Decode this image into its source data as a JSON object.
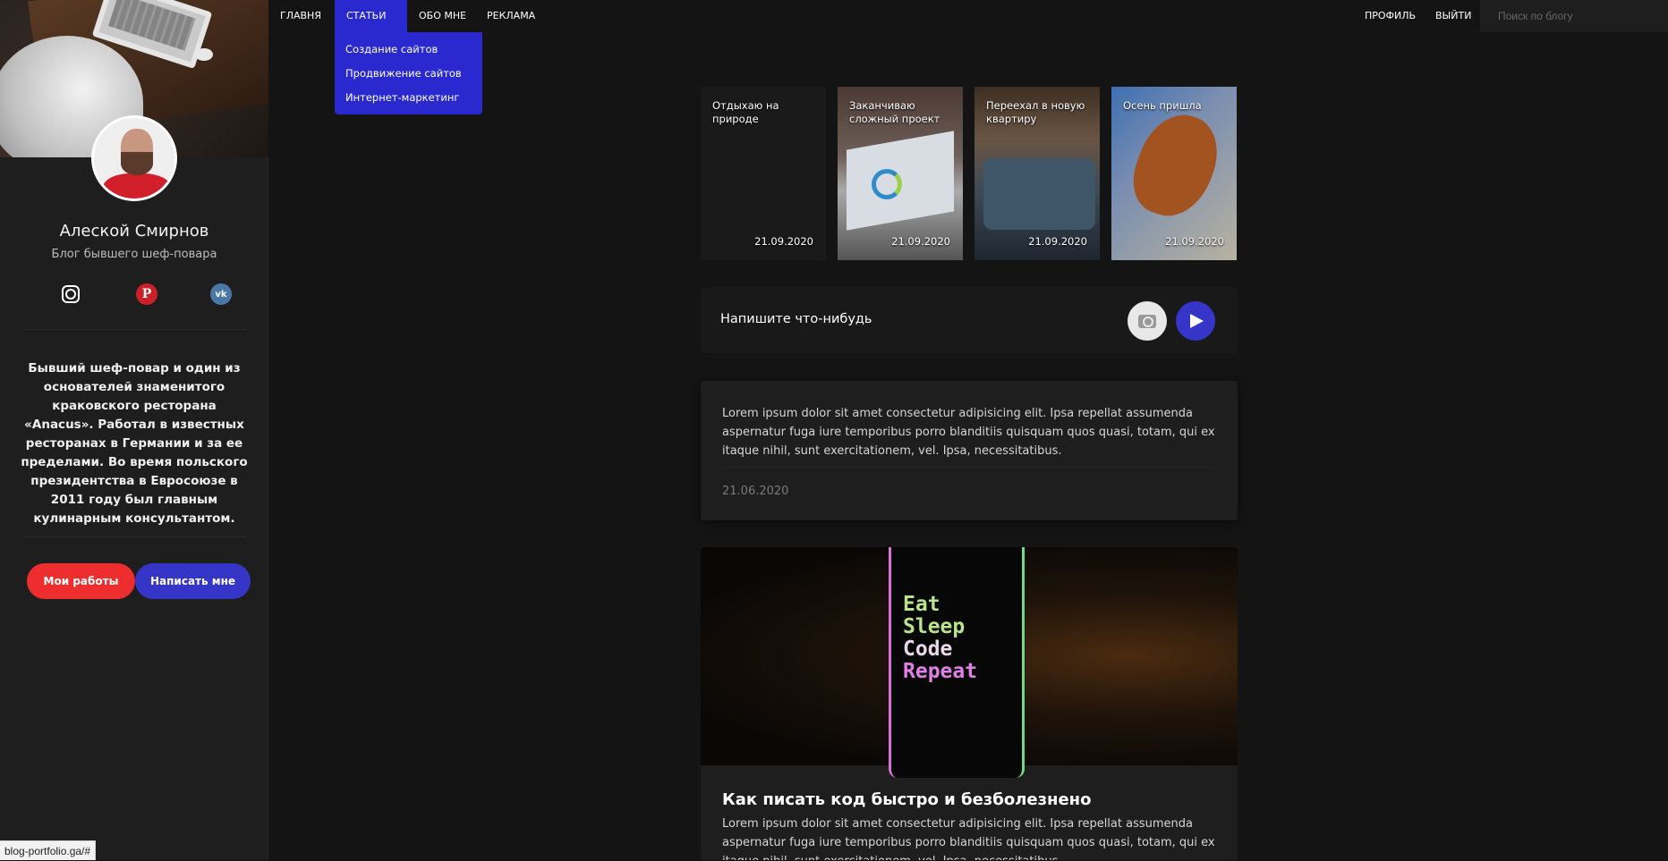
{
  "nav": {
    "home": "ГЛАВНЯ",
    "articles": "СТАТЬИ",
    "about": "ОБО МНЕ",
    "ads": "РЕКЛАМА",
    "profile": "ПРОФИЛЬ",
    "logout": "ВЫЙТИ",
    "search_placeholder": "Поиск по блогу",
    "dropdown": [
      "Создание сайтов",
      "Продвижение сайтов",
      "Интернет-маркетинг"
    ]
  },
  "sidebar": {
    "name": "Алеской Смирнов",
    "subtitle": "Блог бывшего шеф-повара",
    "socials": [
      "instagram-icon",
      "pinterest-icon",
      "vk-icon"
    ],
    "bio": "Бывший шеф-повар и один из основателей знаменитого краковского ресторана «Anacus». Работал в известных ресторанах в Германии и за ее пределами. Во время польского президентства в Евросоюзе в 2011 году был главным кулинарным консультантом.",
    "btn_works": "Мои работы",
    "btn_write": "Написать мне"
  },
  "stories": [
    {
      "title": "Отдыхаю на природе",
      "date": "21.09.2020"
    },
    {
      "title": "Заканчиваю сложный проект",
      "date": "21.09.2020"
    },
    {
      "title": "Переехал в новую квартиру",
      "date": "21.09.2020"
    },
    {
      "title": "Осень пришла",
      "date": "21.09.2020"
    }
  ],
  "composer": {
    "placeholder": "Напишите что-нибудь"
  },
  "post1": {
    "text": "Lorem ipsum dolor sit amet consectetur adipisicing elit. Ipsa repellat assumenda aspernatur fuga iure temporibus porro blanditiis quisquam quos quasi, totam, qui ex itaque nihil, sunt exercitationem, vel. Ipsa, necessitatibus.",
    "date": "21.06.2020"
  },
  "post2": {
    "image_lines": [
      "Eat",
      "Sleep",
      "Code",
      "Repeat"
    ],
    "title": "Как писать код быстро и безболезнено",
    "text": "Lorem ipsum dolor sit amet consectetur adipisicing elit. Ipsa repellat assumenda aspernatur fuga iure temporibus porro blanditiis quisquam quos quasi, totam, qui ex itaque nihil, sunt exercitationem, vel. Ipsa, necessitatibus."
  },
  "statusbar": "blog-portfolio.ga/#",
  "colors": {
    "accent_blue": "#2929cf",
    "button_red": "#ee2e2e",
    "button_blue": "#3535c8"
  }
}
